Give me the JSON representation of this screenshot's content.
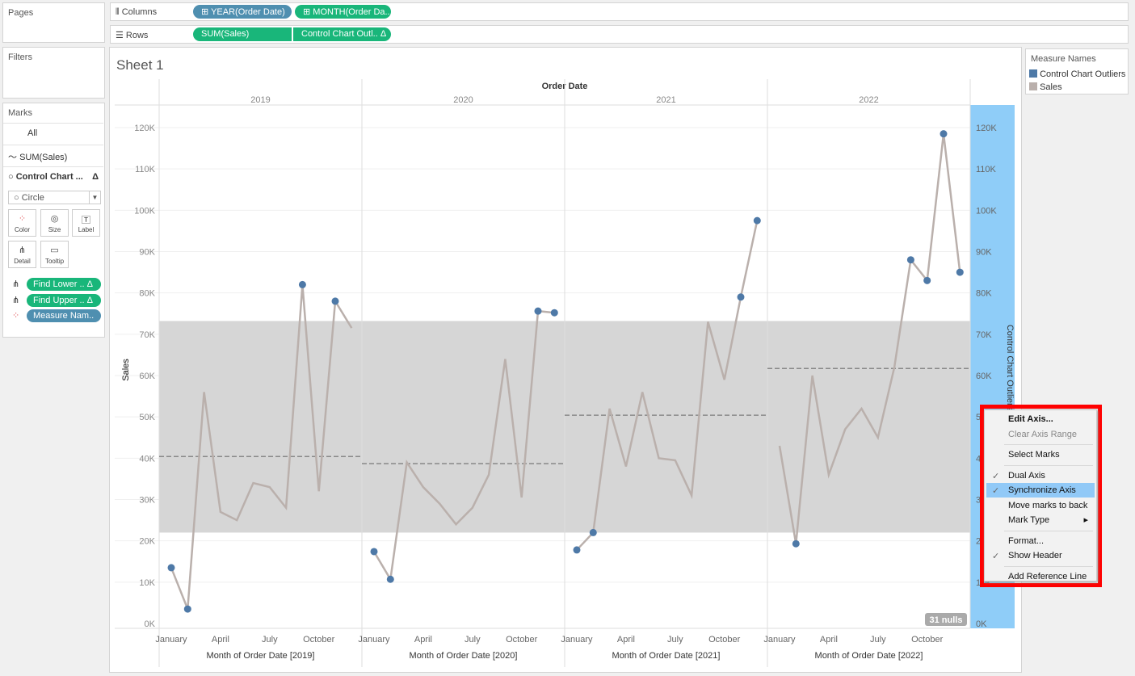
{
  "panels": {
    "pages": "Pages",
    "filters": "Filters",
    "marks": "Marks"
  },
  "shelves": {
    "columns_label": "Columns",
    "rows_label": "Rows",
    "columns": [
      "YEAR(Order Date)",
      "MONTH(Order Da.."
    ],
    "rows": [
      "SUM(Sales)",
      "Control Chart Outl.. Δ"
    ]
  },
  "marks": {
    "all": "All",
    "sales": "SUM(Sales)",
    "control": "Control Chart ...",
    "delta": "Δ",
    "mark_type": "Circle",
    "cards": [
      "Color",
      "Size",
      "Label",
      "Detail",
      "Tooltip"
    ],
    "pills": [
      "Find Lower ..  Δ",
      "Find Upper ..  Δ",
      "Measure Nam.."
    ]
  },
  "sheet": {
    "title": "Sheet 1",
    "column_header": "Order Date",
    "left_axis_title": "Sales",
    "right_axis_title": "Control Chart Outliers",
    "nulls": "31 nulls"
  },
  "legend": {
    "title": "Measure Names",
    "items": [
      {
        "label": "Control Chart Outliers",
        "color": "#4e79a7"
      },
      {
        "label": "Sales",
        "color": "#bab0ac"
      }
    ]
  },
  "context_menu": {
    "items": [
      {
        "label": "Edit Axis...",
        "bold": true
      },
      {
        "label": "Clear Axis Range",
        "disabled": true
      },
      {
        "sep": true
      },
      {
        "label": "Select Marks"
      },
      {
        "sep": true
      },
      {
        "label": "Dual Axis",
        "checked": true
      },
      {
        "label": "Synchronize Axis",
        "checked": true,
        "highlighted": true
      },
      {
        "label": "Move marks to back"
      },
      {
        "label": "Mark Type",
        "submenu": true
      },
      {
        "sep": true
      },
      {
        "label": "Format..."
      },
      {
        "label": "Show Header",
        "checked": true
      },
      {
        "sep": true
      },
      {
        "label": "Add Reference Line"
      }
    ]
  },
  "chart_data": {
    "type": "line",
    "years": [
      "2019",
      "2020",
      "2021",
      "2022"
    ],
    "month_ticks": [
      "January",
      "April",
      "July",
      "October"
    ],
    "xlabels": [
      "Month of Order Date [2019]",
      "Month of Order Date [2020]",
      "Month of Order Date [2021]",
      "Month of Order Date [2022]"
    ],
    "ylabel": "Sales",
    "ylim": [
      0,
      120000
    ],
    "yticks": [
      "0K",
      "10K",
      "20K",
      "30K",
      "40K",
      "50K",
      "60K",
      "70K",
      "80K",
      "90K",
      "100K",
      "110K",
      "120K"
    ],
    "series": [
      {
        "name": "Sales",
        "color": "#bab0ac",
        "values": [
          [
            13500,
            3500,
            56000,
            27000,
            25000,
            34000,
            33000,
            28000,
            82000,
            32000,
            78000,
            71500
          ],
          [
            17400,
            10700,
            39000,
            33000,
            29000,
            24000,
            28000,
            36000,
            64000,
            30500,
            75600,
            75200
          ],
          [
            17800,
            22000,
            52000,
            38000,
            56000,
            40000,
            39500,
            31000,
            73000,
            59000,
            79000,
            97500
          ],
          [
            43000,
            19300,
            60000,
            36000,
            47000,
            52000,
            45000,
            62000,
            88000,
            83000,
            118500,
            85000
          ]
        ]
      }
    ],
    "outliers_color": "#4e79a7",
    "outlier_months": [
      [
        1,
        2,
        9,
        11
      ],
      [
        1,
        2,
        11,
        12
      ],
      [
        1,
        2,
        11,
        12
      ],
      [
        2,
        9,
        10,
        11,
        12
      ]
    ],
    "band": [
      22000,
      73200
    ],
    "averages": [
      40400,
      38700,
      50400,
      61700
    ]
  }
}
